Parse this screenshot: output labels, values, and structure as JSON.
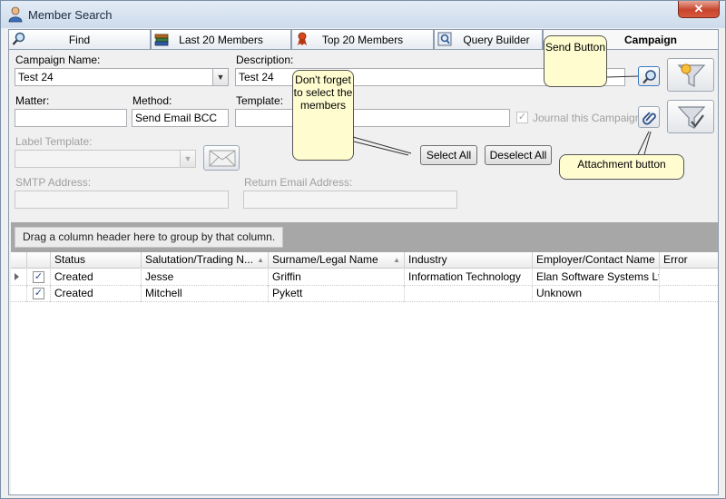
{
  "window": {
    "title": "Member Search",
    "close_label": "✕"
  },
  "tabs": [
    {
      "label": "Find",
      "icon": "magnifier-icon",
      "active": false
    },
    {
      "label": "Last 20 Members",
      "icon": "books-icon",
      "active": false
    },
    {
      "label": "Top 20 Members",
      "icon": "ribbon-icon",
      "active": false
    },
    {
      "label": "Query Builder",
      "icon": "query-icon",
      "active": false
    },
    {
      "label": "Campaign",
      "icon": "",
      "active": true
    }
  ],
  "form": {
    "campaign_name_label": "Campaign Name:",
    "campaign_name_value": "Test 24",
    "description_label": "Description:",
    "description_value": "Test 24",
    "matter_label": "Matter:",
    "matter_value": "",
    "method_label": "Method:",
    "method_value": "Send Email BCC",
    "template_label": "Template:",
    "template_value": "",
    "journal_label": "Journal this Campaign",
    "journal_checked": true,
    "label_template_label": "Label Template:",
    "label_template_value": "",
    "smtp_label": "SMTP Address:",
    "smtp_value": "",
    "return_email_label": "Return Email Address:",
    "return_email_value": ""
  },
  "buttons": {
    "select_all": "Select All",
    "deselect_all": "Deselect All"
  },
  "callouts": {
    "send_button": "Send Button",
    "members_note": "Don't forget to select the members",
    "attachment_button": "Attachment button"
  },
  "grid": {
    "group_hint": "Drag a column header here to group by that column.",
    "columns": [
      "Status",
      "Salutation/Trading N...",
      "Surname/Legal Name",
      "Industry",
      "Employer/Contact Name",
      "Error"
    ],
    "rows": [
      {
        "checked": true,
        "status": "Created",
        "salutation": "Jesse",
        "surname": "Griffin",
        "industry": "Information Technology",
        "employer": "Elan Software Systems Ltd",
        "error": ""
      },
      {
        "checked": true,
        "status": "Created",
        "salutation": "Mitchell",
        "surname": "Pykett",
        "industry": "",
        "employer": "Unknown",
        "error": ""
      }
    ]
  },
  "colors": {
    "callout_bg": "#fffdd0",
    "group_area_bg": "#a7a7a7",
    "close_red": "#c6452c"
  }
}
